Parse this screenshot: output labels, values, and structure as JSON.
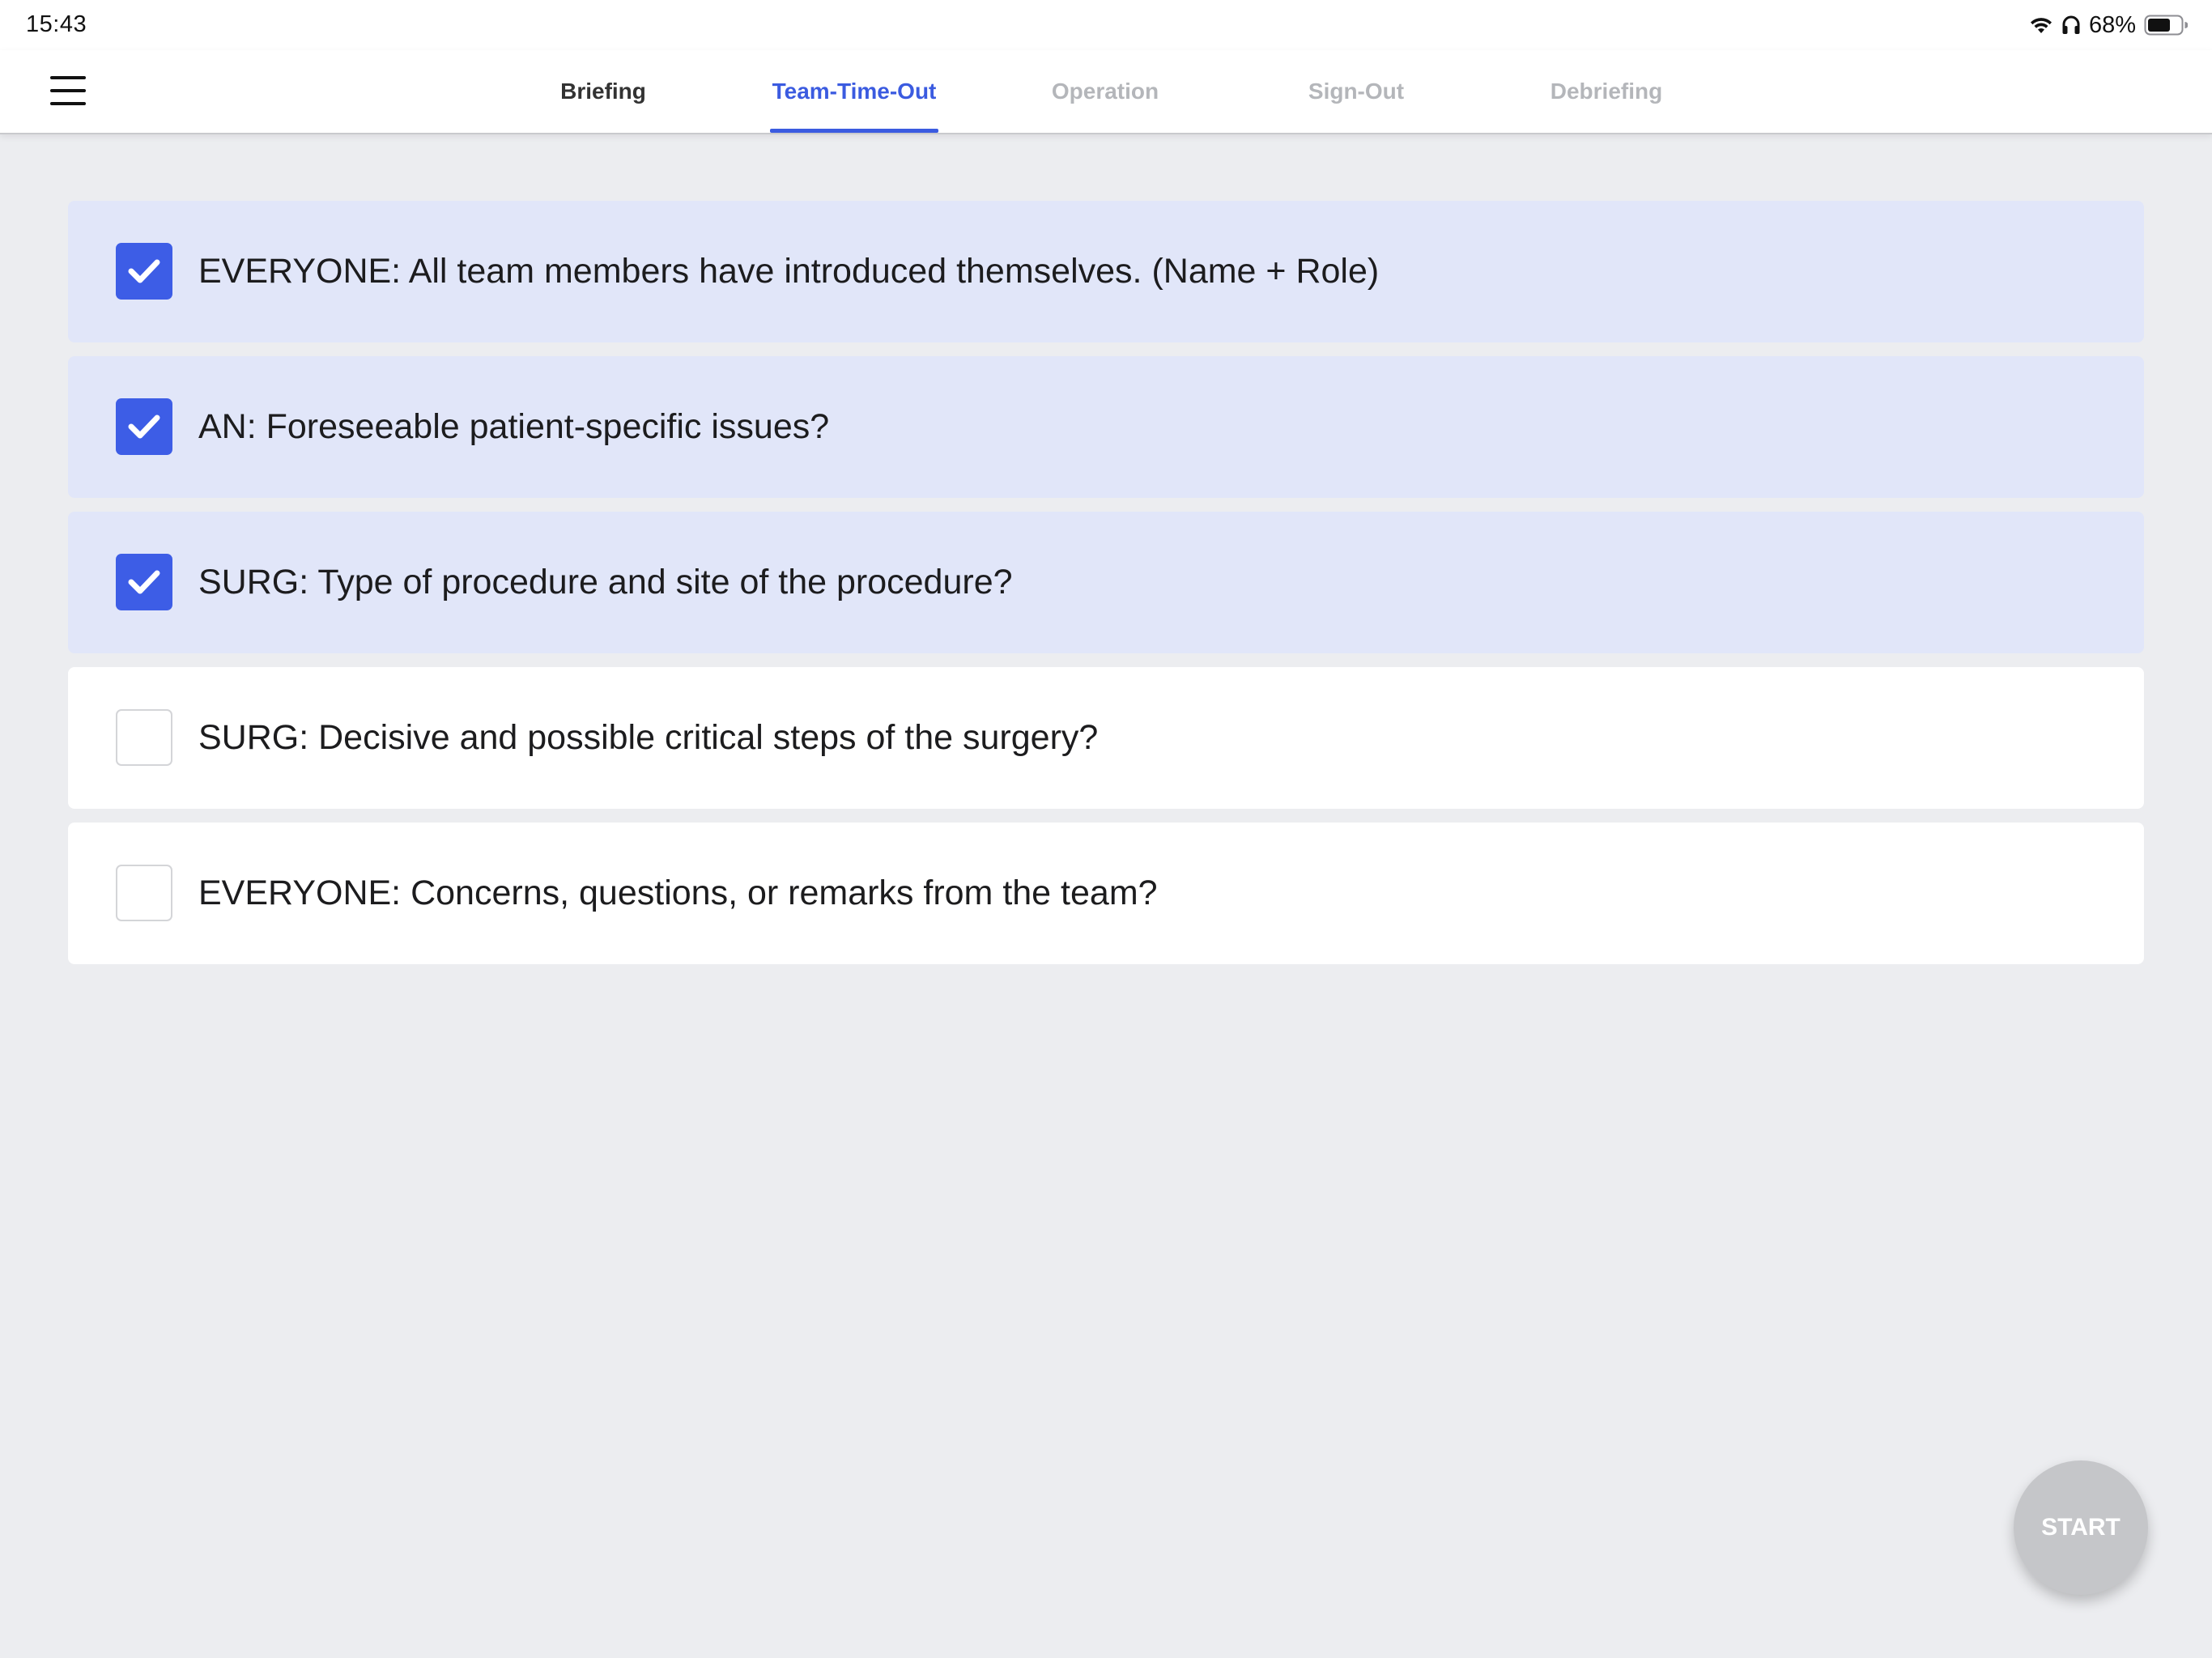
{
  "status_bar": {
    "time": "15:43",
    "battery_percent": "68%",
    "icons": [
      "wifi-icon",
      "headphones-icon",
      "battery-icon"
    ],
    "battery_level": 0.68
  },
  "header": {
    "menu_icon": "hamburger-menu-icon",
    "tabs": [
      {
        "label": "Briefing",
        "state": "done"
      },
      {
        "label": "Team-Time-Out",
        "state": "active"
      },
      {
        "label": "Operation",
        "state": "pending"
      },
      {
        "label": "Sign-Out",
        "state": "pending"
      },
      {
        "label": "Debriefing",
        "state": "pending"
      }
    ]
  },
  "checklist": {
    "items": [
      {
        "label": "EVERYONE: All team members have introduced themselves. (Name + Role)",
        "checked": true
      },
      {
        "label": "AN: Foreseeable patient-specific issues?",
        "checked": true
      },
      {
        "label": "SURG: Type of procedure and site of the procedure?",
        "checked": true
      },
      {
        "label": "SURG: Decisive and possible critical steps of the surgery?",
        "checked": false
      },
      {
        "label": "EVERYONE: Concerns, questions, or remarks from the team?",
        "checked": false
      }
    ]
  },
  "actions": {
    "start_label": "START"
  },
  "colors": {
    "accent": "#3b5be0",
    "checked_row": "#e1e6f9",
    "background": "#ecedf0",
    "start_button": "#c5c6c9"
  }
}
